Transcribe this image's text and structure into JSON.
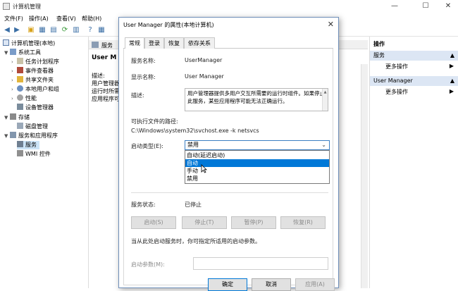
{
  "window": {
    "title": "计算机管理",
    "controls": [
      "—",
      "☐",
      "✕"
    ]
  },
  "menu": [
    "文件(F)",
    "操作(A)",
    "查看(V)",
    "帮助(H)"
  ],
  "tree": {
    "root": "计算机管理(本地)",
    "system_tools": "系统工具",
    "task_scheduler": "任务计划程序",
    "event_viewer": "事件查看器",
    "shared_folders": "共享文件夹",
    "local_users": "本地用户和组",
    "performance": "性能",
    "device_manager": "设备管理器",
    "storage": "存储",
    "disk_mgmt": "磁盘管理",
    "services_apps": "服务和应用程序",
    "services": "服务",
    "wmi": "WMI 控件"
  },
  "center": {
    "tab_label": "服务",
    "header": "User M",
    "desc_label": "描述:",
    "desc_lines": [
      "用户管理器",
      "运行时所需",
      "应用程序可"
    ]
  },
  "actions": {
    "title": "操作",
    "section1": "服务",
    "item1": "更多操作",
    "section2": "User Manager",
    "item2": "更多操作",
    "arrow": "▶"
  },
  "dialog": {
    "title": "User Manager 的属性(本地计算机)",
    "close": "✕",
    "tabs": [
      "常规",
      "登录",
      "恢复",
      "依存关系"
    ],
    "service_name_label": "服务名称:",
    "service_name": "UserManager",
    "display_name_label": "显示名称:",
    "display_name": "User Manager",
    "description_label": "描述:",
    "description": "用户管理器提供多用户交互所需要的运行时组件。如果停止此服务，某些应用程序可能无法正确运行。",
    "exe_path_label": "可执行文件的路径:",
    "exe_path": "C:\\Windows\\system32\\svchost.exe -k netsvcs",
    "startup_type_label": "启动类型(E):",
    "startup_type_value": "禁用",
    "startup_options": [
      "自动(延迟启动)",
      "自动",
      "手动",
      "禁用"
    ],
    "status_label": "服务状态:",
    "status_value": "已停止",
    "btn_start": "启动(S)",
    "btn_stop": "停止(T)",
    "btn_pause": "暂停(P)",
    "btn_resume": "恢复(R)",
    "hint": "当从此处启动服务时，你可指定所适用的启动参数。",
    "params_label": "启动参数(M):",
    "btn_ok": "确定",
    "btn_cancel": "取消",
    "btn_apply": "应用(A)"
  },
  "colors": {
    "accent": "#0078d7",
    "selection": "#cce4f7",
    "header_band": "#dce6f4"
  }
}
